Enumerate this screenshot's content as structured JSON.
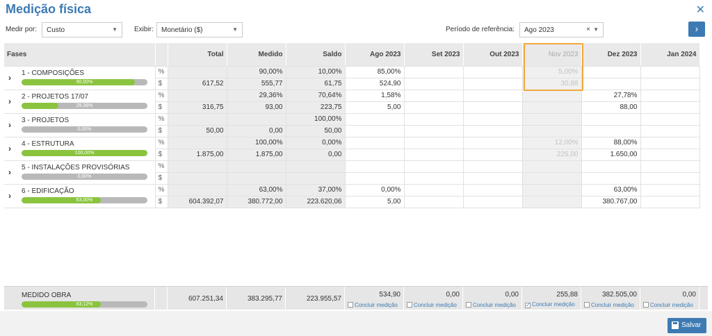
{
  "title": "Medição física",
  "toolbar": {
    "medir_label": "Medir por:",
    "medir_value": "Custo",
    "exibir_label": "Exibir:",
    "exibir_value": "Monetário ($)",
    "periodo_label": "Período de referência:",
    "periodo_value": "Ago 2023"
  },
  "columns": [
    "Fases",
    "Total",
    "Medido",
    "Saldo",
    "Ago 2023",
    "Set 2023",
    "Out 2023",
    "Nov 2023",
    "Dez 2023",
    "Jan 2024"
  ],
  "phases": [
    {
      "name": "1 - COMPOSIÇÕES",
      "progress": 90,
      "progress_label": "90,00%",
      "pct": [
        "",
        "90,00%",
        "10,00%",
        "85,00%",
        "",
        "",
        "5,00%",
        "",
        ""
      ],
      "val": [
        "617,52",
        "555,77",
        "61,75",
        "524,90",
        "",
        "",
        "30,88",
        "",
        ""
      ]
    },
    {
      "name": "2 - PROJETOS 17/07",
      "progress": 29.36,
      "progress_label": "29,36%",
      "pct": [
        "",
        "29,36%",
        "70,64%",
        "1,58%",
        "",
        "",
        "",
        "27,78%",
        ""
      ],
      "val": [
        "316,75",
        "93,00",
        "223,75",
        "5,00",
        "",
        "",
        "",
        "88,00",
        ""
      ]
    },
    {
      "name": "3 - PROJETOS",
      "progress": 0,
      "progress_label": "0,00%",
      "pct": [
        "",
        "",
        "100,00%",
        "",
        "",
        "",
        "",
        "",
        ""
      ],
      "val": [
        "50,00",
        "0,00",
        "50,00",
        "",
        "",
        "",
        "",
        "",
        ""
      ]
    },
    {
      "name": "4 - ESTRUTURA",
      "progress": 100,
      "progress_label": "100,00%",
      "pct": [
        "",
        "100,00%",
        "0,00%",
        "",
        "",
        "",
        "12,00%",
        "88,00%",
        ""
      ],
      "val": [
        "1.875,00",
        "1.875,00",
        "0,00",
        "",
        "",
        "",
        "225,00",
        "1.650,00",
        ""
      ]
    },
    {
      "name": "5 - INSTALAÇÕES PROVISÓRIAS",
      "progress": 0,
      "progress_label": "0,00%",
      "pct": [
        "",
        "",
        "",
        "",
        "",
        "",
        "",
        "",
        ""
      ],
      "val": [
        "",
        "",
        "",
        "",
        "",
        "",
        "",
        "",
        ""
      ]
    },
    {
      "name": "6 - EDIFICAÇÃO",
      "progress": 63,
      "progress_label": "63,00%",
      "pct": [
        "",
        "63,00%",
        "37,00%",
        "0,00%",
        "",
        "",
        "",
        "63,00%",
        ""
      ],
      "val": [
        "604.392,07",
        "380.772,00",
        "223.620,06",
        "5,00",
        "",
        "",
        "",
        "380.767,00",
        ""
      ]
    }
  ],
  "units": {
    "pct": "%",
    "val": "$"
  },
  "footer": {
    "name": "MEDIDO OBRA",
    "progress": 63.12,
    "progress_label": "63,12%",
    "totals": [
      "607.251,34",
      "383.295,77",
      "223.955,57"
    ],
    "months": [
      {
        "value": "534,90",
        "checked": false
      },
      {
        "value": "0,00",
        "checked": false
      },
      {
        "value": "0,00",
        "checked": false
      },
      {
        "value": "255,88",
        "checked": true
      },
      {
        "value": "382.505,00",
        "checked": false
      },
      {
        "value": "0,00",
        "checked": false
      }
    ],
    "concluir_label": "Concluir medição"
  },
  "save_label": "Salvar",
  "colors": {
    "accent": "#3d7ab3",
    "progress": "#8ac43f",
    "highlight": "#f0a83a"
  }
}
